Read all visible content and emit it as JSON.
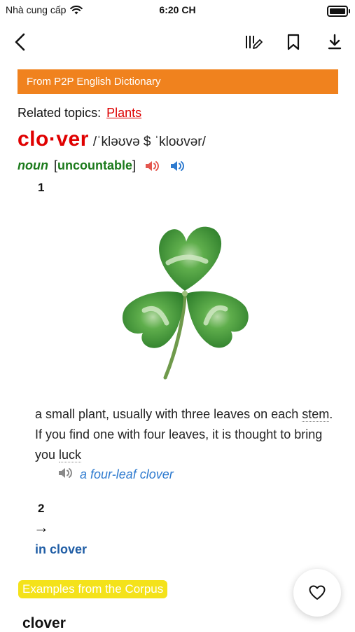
{
  "status_bar": {
    "carrier": "Nhà cung cấp",
    "time": "6:20 CH"
  },
  "toolbar": {
    "icons": [
      "back-arrow-icon",
      "text-settings-icon",
      "bookmark-icon",
      "download-icon"
    ]
  },
  "banner": {
    "label": "From P2P English Dictionary",
    "color": "#f0821e"
  },
  "related": {
    "label": "Related topics:",
    "link": "Plants"
  },
  "entry": {
    "headword": "clo·ver",
    "pronunciation": "/ˈkləʊvə $ ˈkloʊvər/",
    "pos": "noun",
    "grammar_open": "[",
    "grammar": "uncountable",
    "grammar_close": "]",
    "speaker_colors": {
      "british": "#e4574f",
      "american": "#2f7bcf"
    }
  },
  "senses": [
    {
      "number": "1",
      "definition_parts": {
        "a": "a small plant, usually with three leaves on each ",
        "stem": "stem",
        "b": ". If you find one with four leaves, it is thought to bring you ",
        "luck": "luck"
      },
      "example": "a four-leaf clover"
    },
    {
      "number": "2",
      "arrow": "→",
      "phrase": "in clover"
    }
  ],
  "corpus": {
    "badge": "Examples from the Corpus",
    "word": "clover"
  },
  "favorite": {
    "icon": "heart-icon"
  }
}
